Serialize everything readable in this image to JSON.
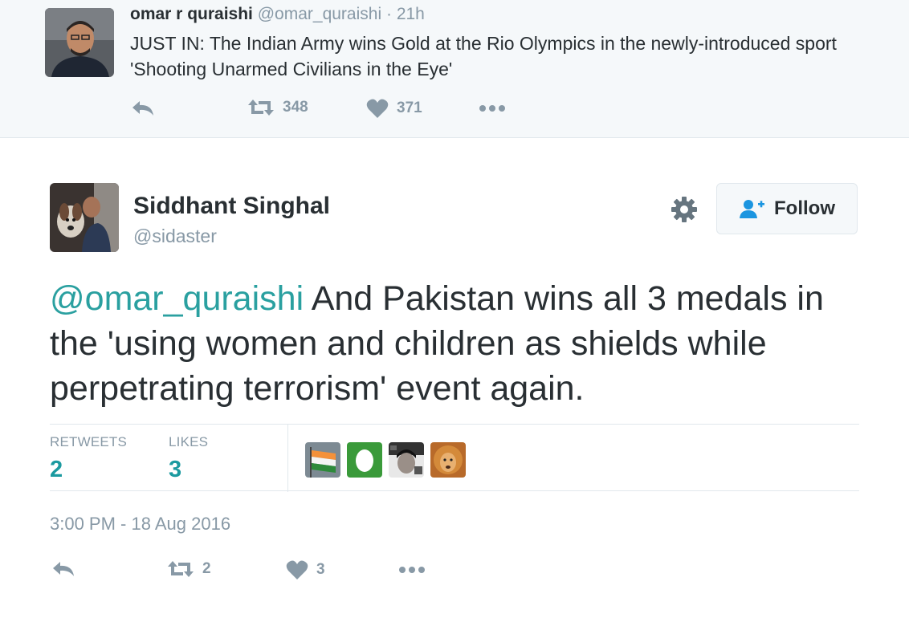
{
  "parent_tweet": {
    "name": "omar r quraishi",
    "handle": "@omar_quraishi",
    "separator": "·",
    "time": "21h",
    "text": "JUST IN: The Indian Army wins Gold at the Rio Olympics in the newly-introduced sport 'Shooting Unarmed Civilians in the Eye'",
    "retweets": "348",
    "likes": "371"
  },
  "main_tweet": {
    "name": "Siddhant Singhal",
    "handle": "@sidaster",
    "follow_label": "Follow",
    "mention": "@omar_quraishi",
    "text": " And Pakistan wins all 3 medals in the 'using women and children as shields while perpetrating terrorism' event again.",
    "stats": {
      "retweets_label": "RETWEETS",
      "retweets": "2",
      "likes_label": "LIKES",
      "likes": "3"
    },
    "timestamp": "3:00 PM - 18 Aug 2016",
    "action_retweets": "2",
    "action_likes": "3"
  },
  "colors": {
    "accent": "#1b9aa0",
    "muted": "#8899a6",
    "text": "#292f33",
    "border": "#e1e8ed",
    "parent_bg": "#f5f8fa"
  },
  "icons": [
    "reply-icon",
    "retweet-icon",
    "heart-icon",
    "more-icon",
    "gear-icon",
    "follow-user-icon"
  ]
}
